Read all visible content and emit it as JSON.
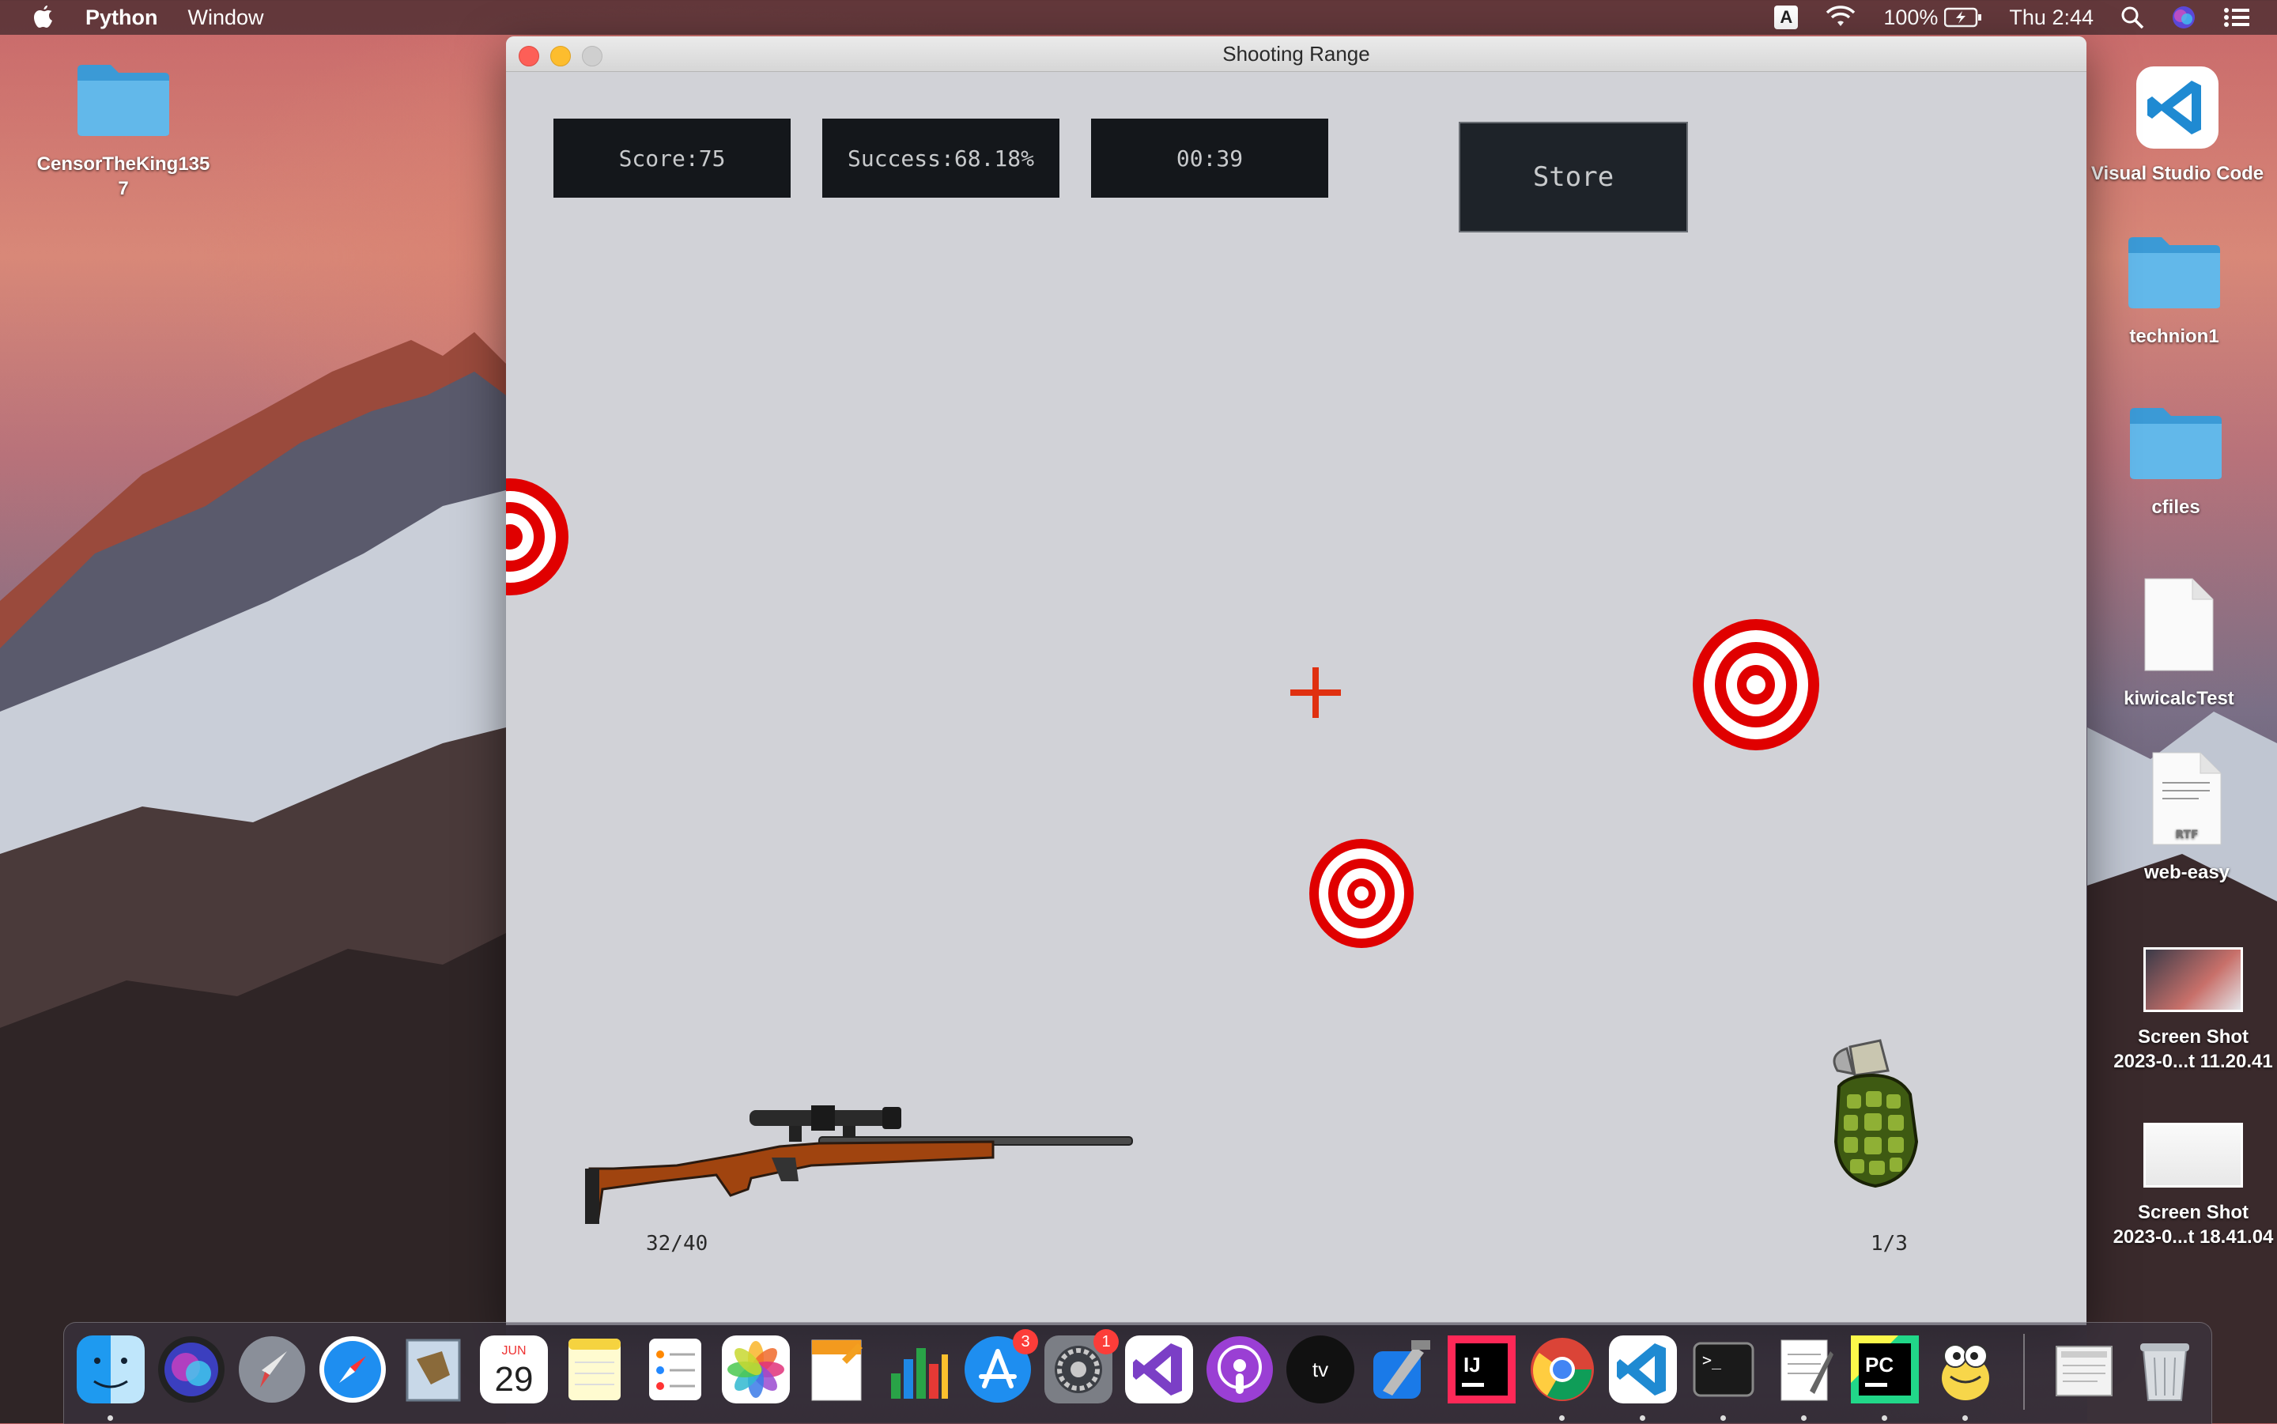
{
  "menubar": {
    "app_name": "Python",
    "menu_items": [
      "Window"
    ],
    "input_indicator": "A",
    "battery": "100%",
    "clock": "Thu 2:44"
  },
  "desktop": {
    "left_icons": [
      {
        "label": "CensorTheKing135\n7",
        "kind": "folder"
      }
    ],
    "right_icons": [
      {
        "label": "Visual Studio Code",
        "kind": "app"
      },
      {
        "label": "technion1",
        "kind": "folder"
      },
      {
        "label": "cfiles",
        "kind": "folder"
      },
      {
        "label": "kiwicalcTest",
        "kind": "document"
      },
      {
        "label": "web-easy",
        "kind": "rtf-document"
      },
      {
        "label": "Screen Shot\n2023-0...t 11.20.41",
        "kind": "screenshot"
      },
      {
        "label": "Screen Shot\n2023-0...t 18.41.04",
        "kind": "screenshot"
      }
    ]
  },
  "window": {
    "title": "Shooting Range",
    "score_label": "Score:75",
    "success_label": "Success:68.18%",
    "timer_label": "00:39",
    "store_label": "Store",
    "rifle_ammo": "32/40",
    "grenade_count": "1/3",
    "colors": {
      "hud_bg": "#14171b",
      "target_red": "#e00000",
      "crosshair": "#e03010",
      "canvas_bg": "#d1d2d7"
    }
  },
  "dock": {
    "apps": [
      "finder-icon",
      "siri-icon",
      "launchpad-icon",
      "safari-icon",
      "mail-icon",
      "calendar-icon",
      "notes-icon",
      "reminders-icon",
      "photos-icon",
      "pages-icon",
      "numbers-icon",
      "app-store-icon",
      "system-preferences-icon",
      "visual-studio-icon",
      "podcasts-icon",
      "apple-tv-icon",
      "xcode-icon",
      "intellij-icon",
      "chrome-icon",
      "vscode-icon",
      "terminal-icon",
      "textedit-icon",
      "pycharm-icon",
      "python-launcher-icon",
      "downloads-stack-icon",
      "trash-icon"
    ],
    "calendar_month": "JUN",
    "calendar_day": "29",
    "app_store_badge": "3",
    "system_prefs_badge": "1"
  }
}
